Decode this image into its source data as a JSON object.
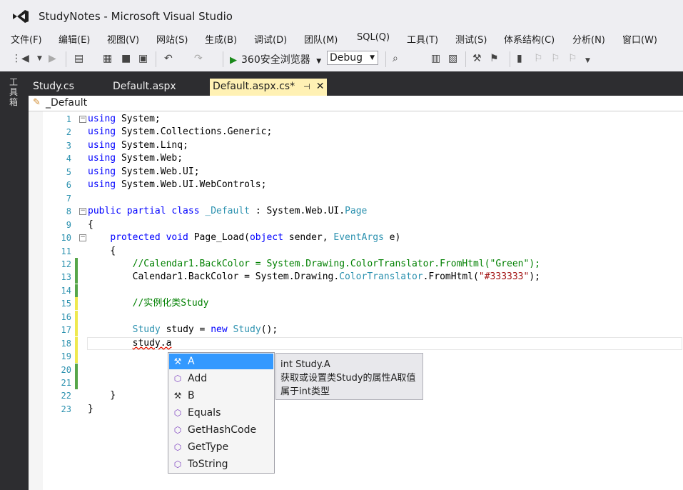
{
  "window": {
    "title": "StudyNotes - Microsoft Visual Studio"
  },
  "menu": [
    "文件(F)",
    "编辑(E)",
    "视图(V)",
    "网站(S)",
    "生成(B)",
    "调试(D)",
    "团队(M)",
    "SQL(Q)",
    "工具(T)",
    "测试(S)",
    "体系结构(C)",
    "分析(N)",
    "窗口(W)"
  ],
  "toolbar": {
    "run_label": "360安全浏览器",
    "config": "Debug"
  },
  "toolbox_label": "工具箱",
  "tabs": [
    {
      "label": "Study.cs",
      "active": false
    },
    {
      "label": "Default.aspx",
      "active": false
    },
    {
      "label": "Default.aspx.cs*",
      "active": true
    }
  ],
  "navigation": {
    "class_name": "_Default"
  },
  "lines": [
    {
      "n": "1",
      "tokens": [
        [
          "kw",
          "using"
        ],
        [
          "pl",
          " System;"
        ]
      ]
    },
    {
      "n": "2",
      "tokens": [
        [
          "kw",
          "using"
        ],
        [
          "pl",
          " System.Collections.Generic;"
        ]
      ]
    },
    {
      "n": "3",
      "tokens": [
        [
          "kw",
          "using"
        ],
        [
          "pl",
          " System.Linq;"
        ]
      ]
    },
    {
      "n": "4",
      "tokens": [
        [
          "kw",
          "using"
        ],
        [
          "pl",
          " System.Web;"
        ]
      ]
    },
    {
      "n": "5",
      "tokens": [
        [
          "kw",
          "using"
        ],
        [
          "pl",
          " System.Web.UI;"
        ]
      ]
    },
    {
      "n": "6",
      "tokens": [
        [
          "kw",
          "using"
        ],
        [
          "pl",
          " System.Web.UI.WebControls;"
        ]
      ]
    },
    {
      "n": "7",
      "tokens": []
    },
    {
      "n": "8",
      "tokens": [
        [
          "kw",
          "public partial class"
        ],
        [
          "pl",
          " "
        ],
        [
          "ty",
          "_Default"
        ],
        [
          "pl",
          " : System.Web.UI."
        ],
        [
          "ty",
          "Page"
        ]
      ]
    },
    {
      "n": "9",
      "tokens": [
        [
          "pl",
          "{"
        ]
      ]
    },
    {
      "n": "10",
      "tokens": [
        [
          "pl",
          "    "
        ],
        [
          "kw",
          "protected void"
        ],
        [
          "pl",
          " Page_Load("
        ],
        [
          "kw",
          "object"
        ],
        [
          "pl",
          " sender, "
        ],
        [
          "ty",
          "EventArgs"
        ],
        [
          "pl",
          " e)"
        ]
      ]
    },
    {
      "n": "11",
      "tokens": [
        [
          "pl",
          "    {"
        ]
      ]
    },
    {
      "n": "12",
      "tokens": [
        [
          "pl",
          "        "
        ],
        [
          "cm",
          "//Calendar1.BackColor = System.Drawing.ColorTranslator.FromHtml(\"Green\");"
        ]
      ]
    },
    {
      "n": "13",
      "tokens": [
        [
          "pl",
          "        Calendar1.BackColor = System.Drawing."
        ],
        [
          "ty",
          "ColorTranslator"
        ],
        [
          "pl",
          ".FromHtml("
        ],
        [
          "st",
          "\"#333333\""
        ],
        [
          "pl",
          ");"
        ]
      ]
    },
    {
      "n": "14",
      "tokens": []
    },
    {
      "n": "15",
      "tokens": [
        [
          "pl",
          "        "
        ],
        [
          "cm",
          "//实例化类Study"
        ]
      ]
    },
    {
      "n": "16",
      "tokens": []
    },
    {
      "n": "17",
      "tokens": [
        [
          "pl",
          "        "
        ],
        [
          "ty",
          "Study"
        ],
        [
          "pl",
          " study = "
        ],
        [
          "kw",
          "new"
        ],
        [
          "pl",
          " "
        ],
        [
          "ty",
          "Study"
        ],
        [
          "pl",
          "();"
        ]
      ]
    },
    {
      "n": "18",
      "tokens": [
        [
          "pl",
          "        "
        ],
        [
          "sq",
          "study.a"
        ]
      ]
    },
    {
      "n": "19",
      "tokens": []
    },
    {
      "n": "20",
      "tokens": []
    },
    {
      "n": "21",
      "tokens": []
    },
    {
      "n": "22",
      "tokens": [
        [
          "pl",
          "    }"
        ]
      ]
    },
    {
      "n": "23",
      "tokens": [
        [
          "pl",
          "}"
        ]
      ]
    }
  ],
  "intellisense": {
    "items": [
      {
        "label": "A",
        "kind": "property",
        "selected": true
      },
      {
        "label": "Add",
        "kind": "method",
        "selected": false
      },
      {
        "label": "B",
        "kind": "property",
        "selected": false
      },
      {
        "label": "Equals",
        "kind": "method",
        "selected": false
      },
      {
        "label": "GetHashCode",
        "kind": "method",
        "selected": false
      },
      {
        "label": "GetType",
        "kind": "method",
        "selected": false
      },
      {
        "label": "ToString",
        "kind": "method",
        "selected": false
      }
    ],
    "tooltip": {
      "signature": "int Study.A",
      "desc1": "获取或设置类Study的属性A取值",
      "desc2": "属于int类型"
    }
  }
}
